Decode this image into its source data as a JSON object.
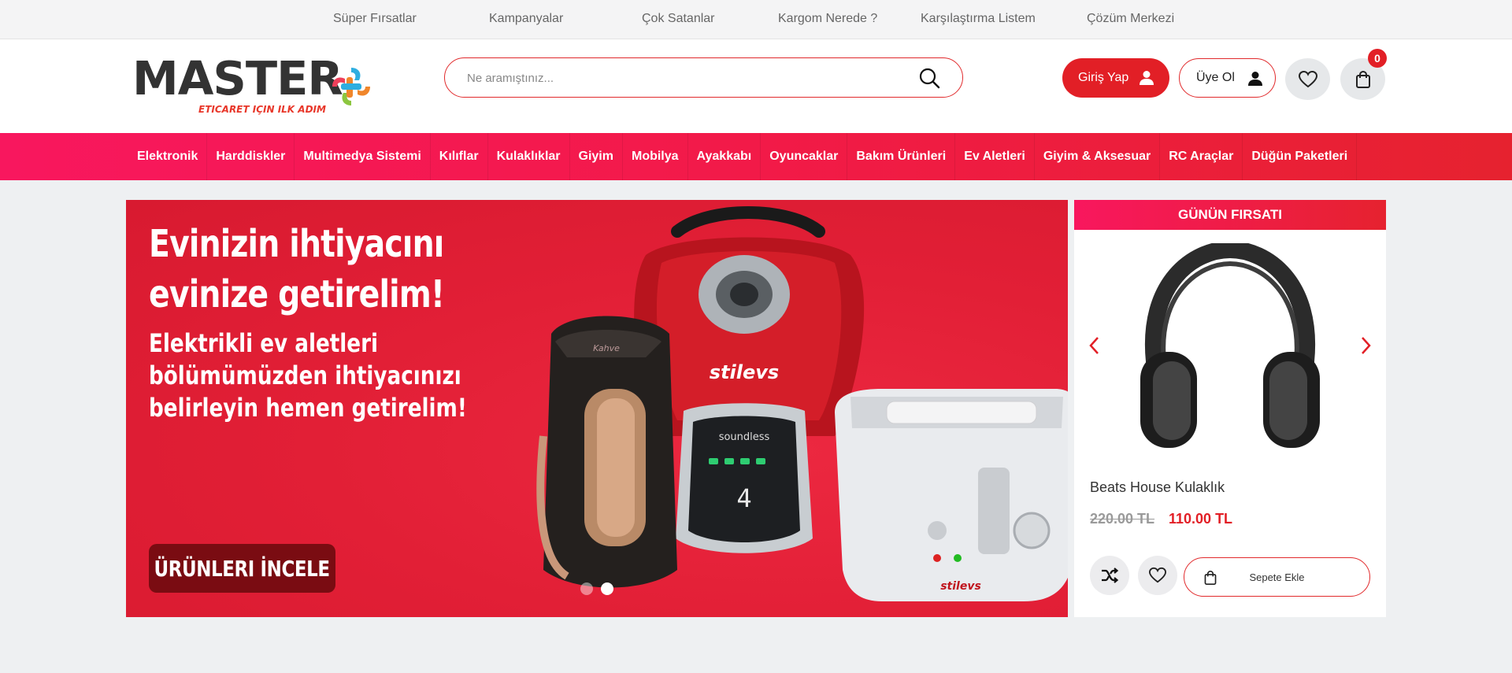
{
  "topbar": {
    "links": [
      "Süper Fırsatlar",
      "Kampanyalar",
      "Çok Satanlar",
      "Kargom Nerede ?",
      "Karşılaştırma Listem",
      "Çözüm Merkezi"
    ]
  },
  "header": {
    "logo_text": "MASTER",
    "logo_tagline": "ETICARET IÇIN ILK ADIM",
    "search_placeholder": "Ne aramıştınız...",
    "login_label": "Giriş Yap",
    "register_label": "Üye Ol",
    "cart_count": "0"
  },
  "categories": [
    "Elektronik",
    "Harddiskler",
    "Multimedya Sistemi",
    "Kılıflar",
    "Kulaklıklar",
    "Giyim",
    "Mobilya",
    "Ayakkabı",
    "Oyuncaklar",
    "Bakım Ürünleri",
    "Ev Aletleri",
    "Giyim & Aksesuar",
    "RC Araçlar",
    "Düğün Paketleri"
  ],
  "banner": {
    "headline": "Evinizin ihtiyacını\nevinize getirelim!",
    "body": "Elektrikli ev aletleri\nbölümümüzden ihtiyacınızı\nbelirleyin hemen getirelim!",
    "cta": "ÜRÜNLERI İNCELE",
    "slides": 2,
    "active_slide": 2,
    "product_labels": [
      "stilevs",
      "soundless",
      "Kahve",
      "stilevs"
    ]
  },
  "deal": {
    "title": "GÜNÜN FIRSATI",
    "product_name": "Beats House Kulaklık",
    "old_price": "220.00 TL",
    "new_price": "110.00 TL",
    "add_to_cart": "Sepete Ekle"
  },
  "colors": {
    "brand_red": "#e21f26",
    "nav_gradient_start": "#f8175e",
    "nav_gradient_end": "#e6222f"
  }
}
